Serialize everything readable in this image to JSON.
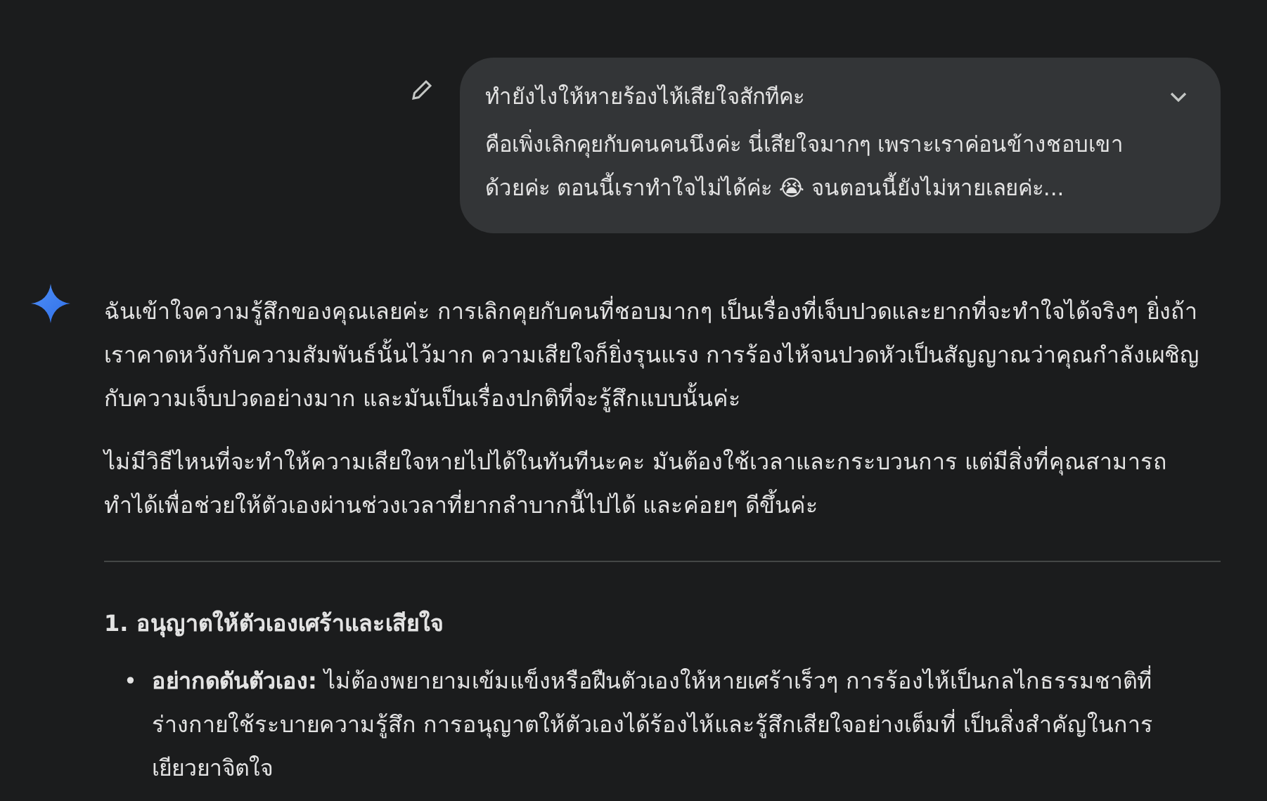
{
  "user_message": {
    "title": "ทำยังไงให้หายร้องไห้เสียใจสักทีคะ",
    "text": "คือเพิ่งเลิกคุยกับคนคนนึงค่ะ นี่เสียใจมากๆ เพราะเราค่อนข้างชอบเขาด้วยค่ะ ตอนนี้เราทำใจไม่ได้ค่ะ 😭 จนตอนนี้ยังไม่หายเลยค่ะ...",
    "expanded": false
  },
  "response": {
    "paragraphs": [
      "ฉันเข้าใจความรู้สึกของคุณเลยค่ะ การเลิกคุยกับคนที่ชอบมากๆ เป็นเรื่องที่เจ็บปวดและยากที่จะทำใจได้จริงๆ ยิ่งถ้าเราคาดหวังกับความสัมพันธ์นั้นไว้มาก ความเสียใจก็ยิ่งรุนแรง การร้องไห้จนปวดหัวเป็นสัญญาณว่าคุณกำลังเผชิญกับความเจ็บปวดอย่างมาก และมันเป็นเรื่องปกติที่จะรู้สึกแบบนั้นค่ะ",
      "ไม่มีวิธีไหนที่จะทำให้ความเสียใจหายไปได้ในทันทีนะคะ มันต้องใช้เวลาและกระบวนการ แต่มีสิ่งที่คุณสามารถทำได้เพื่อช่วยให้ตัวเองผ่านช่วงเวลาที่ยากลำบากนี้ไปได้ และค่อยๆ ดีขึ้นค่ะ"
    ],
    "sections": [
      {
        "heading": "1. อนุญาตให้ตัวเองเศร้าและเสียใจ",
        "bullets": [
          {
            "marker": "•",
            "text": "**อย่ากดดันตัวเอง:** ไม่ต้องพยายามเข้มแข็งหรือฝืนตัวเองให้หายเศร้าเร็วๆ การร้องไห้เป็นกลไกธรรมชาติที่ร่างกายใช้ระบายความรู้สึก การอนุญาตให้ตัวเองได้ร้องไห้และรู้สึกเสียใจอย่างเต็มที่ เป็นสิ่งสำคัญในการเยียวยาจิตใจ"
          }
        ]
      }
    ]
  }
}
